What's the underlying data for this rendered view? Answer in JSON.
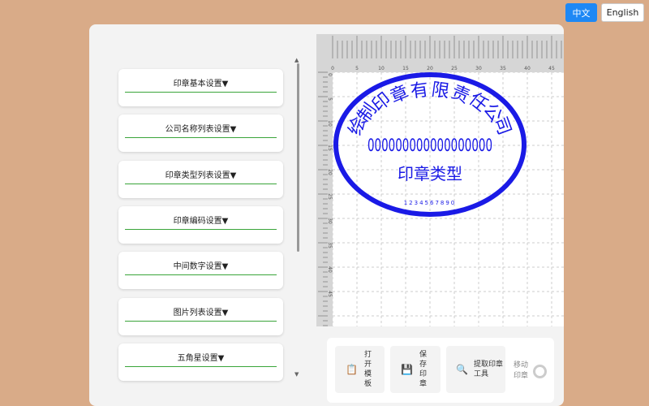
{
  "lang": {
    "zh": "中文",
    "en": "English"
  },
  "sections": [
    "印章基本设置▼",
    "公司名称列表设置▼",
    "印章类型列表设置▼",
    "印章编码设置▼",
    "中间数字设置▼",
    "图片列表设置▼",
    "五角星设置▼"
  ],
  "ruler": {
    "top": [
      "0",
      "5",
      "10",
      "15",
      "20",
      "25",
      "30",
      "35",
      "40",
      "45"
    ],
    "left": [
      "0",
      "5",
      "10",
      "15",
      "20",
      "25",
      "30",
      "35",
      "40",
      "45"
    ]
  },
  "stamp": {
    "company": "绘制印章有限责任公司",
    "number": "000000000000000000",
    "type": "印章类型",
    "code": "1234567890",
    "color": "#1a1ae6"
  },
  "toolbar": {
    "open": "打开模板",
    "save": "保存印章",
    "extract": "提取印章工具",
    "move": "移动印章"
  }
}
